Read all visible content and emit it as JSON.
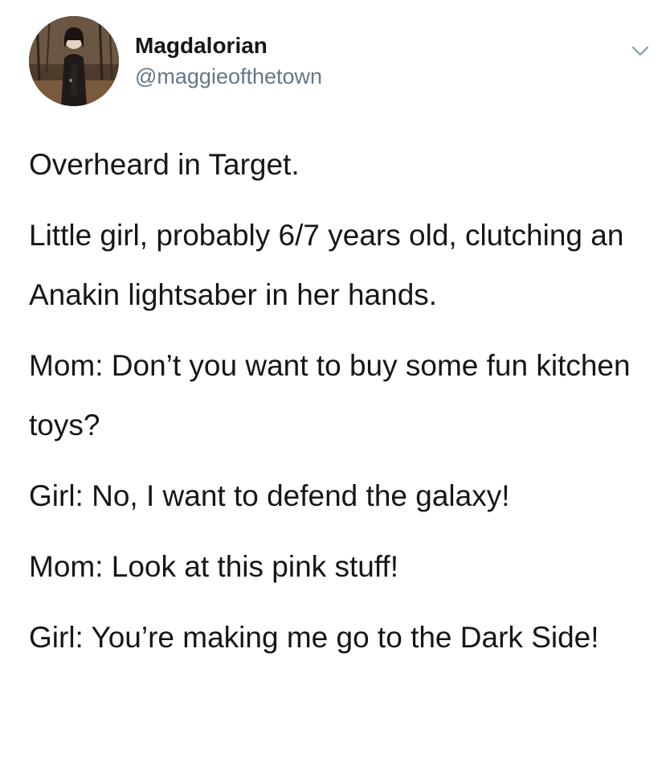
{
  "tweet": {
    "author": {
      "display_name": "Magdalorian",
      "handle": "@maggieofthetown"
    },
    "menu_icon": "chevron-down-icon",
    "paragraphs": [
      "Overheard in Target.",
      "Little girl, probably 6/7 years old, clutching an Anakin lightsaber in her hands.",
      "Mom: Don’t you want to buy some fun kitchen toys?",
      "Girl: No, I want to defend the galaxy!",
      "Mom: Look at this pink stuff!",
      "Girl: You’re making me go to the Dark Side!"
    ]
  },
  "colors": {
    "text": "#14171a",
    "secondary": "#657786",
    "chevron": "#8899a6",
    "background": "#ffffff"
  }
}
